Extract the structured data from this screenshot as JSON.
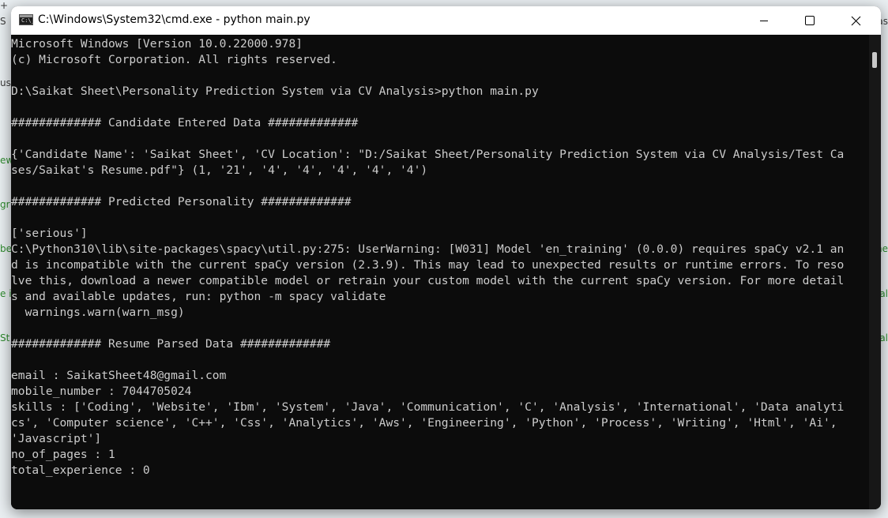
{
  "window": {
    "title": "C:\\Windows\\System32\\cmd.exe - python  main.py",
    "app_icon_glyph": "C:\\_",
    "icons": {
      "minimize": "minimize-icon",
      "maximize": "maximize-icon",
      "close": "close-icon"
    }
  },
  "console": {
    "lines": [
      "Microsoft Windows [Version 10.0.22000.978]",
      "(c) Microsoft Corporation. All rights reserved.",
      "",
      "D:\\Saikat Sheet\\Personality Prediction System via CV Analysis>python main.py",
      "",
      "############# Candidate Entered Data #############",
      "",
      "{'Candidate Name': 'Saikat Sheet', 'CV Location': \"D:/Saikat Sheet/Personality Prediction System via CV Analysis/Test Ca",
      "ses/Saikat's Resume.pdf\"} (1, '21', '4', '4', '4', '4', '4')",
      "",
      "############# Predicted Personality #############",
      "",
      "['serious']",
      "C:\\Python310\\lib\\site-packages\\spacy\\util.py:275: UserWarning: [W031] Model 'en_training' (0.0.0) requires spaCy v2.1 an",
      "d is incompatible with the current spaCy version (2.3.9). This may lead to unexpected results or runtime errors. To reso",
      "lve this, download a newer compatible model or retrain your custom model with the current spaCy version. For more detail",
      "s and available updates, run: python -m spacy validate",
      "  warnings.warn(warn_msg)",
      "",
      "############# Resume Parsed Data #############",
      "",
      "email : SaikatSheet48@gmail.com",
      "mobile_number : 7044705024",
      "skills : ['Coding', 'Website', 'Ibm', 'System', 'Java', 'Communication', 'C', 'Analysis', 'International', 'Data analyti",
      "cs', 'Computer science', 'C++', 'Css', 'Analytics', 'Aws', 'Engineering', 'Python', 'Process', 'Writing', 'Html', 'Ai',",
      "'Javascript']",
      "no_of_pages : 1",
      "total_experience : 0"
    ]
  },
  "background": {
    "left_fragments": [
      "S",
      "y",
      "ew",
      "us",
      "gr",
      "be",
      "e i",
      "St",
      "+"
    ],
    "right_fragments": [
      "as",
      "he",
      "al",
      "al"
    ]
  },
  "colors": {
    "console_bg": "#0c0c0c",
    "console_fg": "#cccccc",
    "titlebar_bg": "#ffffff"
  }
}
